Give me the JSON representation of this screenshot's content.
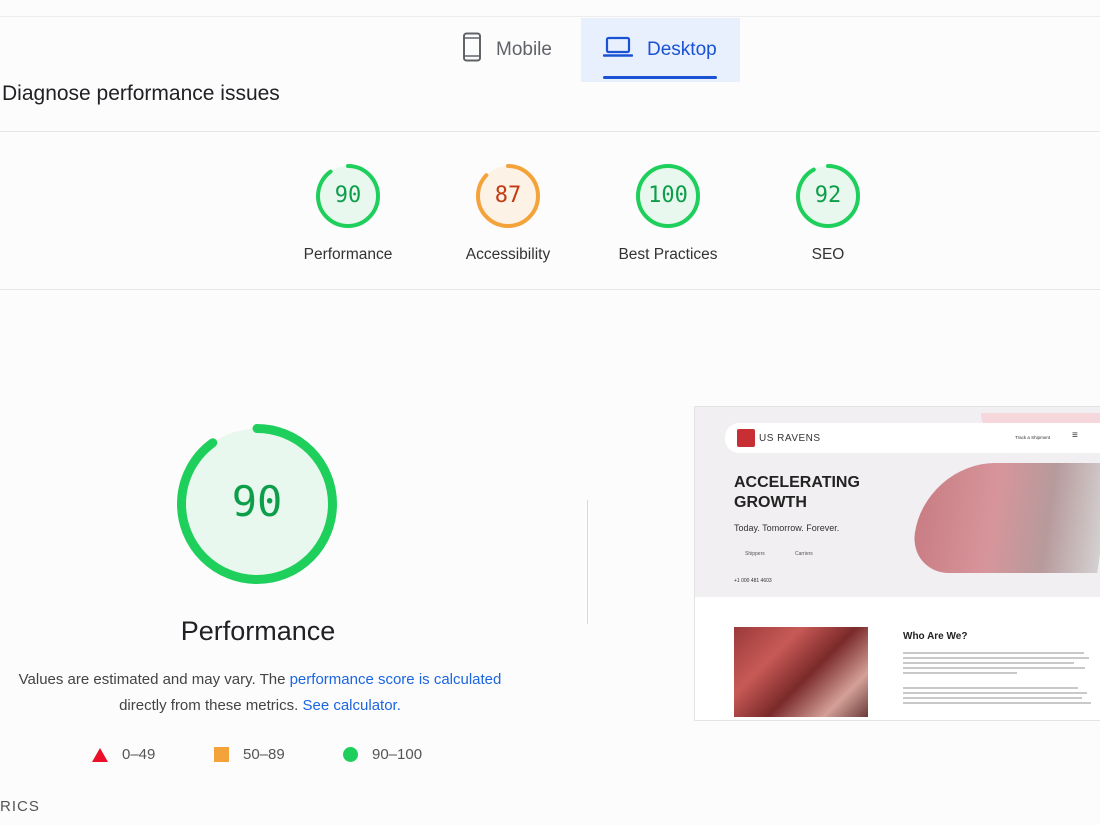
{
  "tabs": {
    "mobile": "Mobile",
    "desktop": "Desktop"
  },
  "section_title": "Diagnose performance issues",
  "scores": [
    {
      "value": "90",
      "label": "Performance",
      "color": "#1fcf5c",
      "text_color": "#0d9e4a",
      "bg": "#e9f8ee",
      "fraction": 0.9
    },
    {
      "value": "87",
      "label": "Accessibility",
      "color": "#f4a23a",
      "text_color": "#c33a10",
      "bg": "#fdf2e6",
      "fraction": 0.87
    },
    {
      "value": "100",
      "label": "Best Practices",
      "color": "#1fcf5c",
      "text_color": "#0d9e4a",
      "bg": "#e9f8ee",
      "fraction": 1.0
    },
    {
      "value": "92",
      "label": "SEO",
      "color": "#1fcf5c",
      "text_color": "#0d9e4a",
      "bg": "#e9f8ee",
      "fraction": 0.92
    }
  ],
  "performance": {
    "score": "90",
    "fraction": 0.9,
    "title": "Performance",
    "desc_prefix": "Values are estimated and may vary. The ",
    "desc_link": "performance score is calculated",
    "desc_middle": "directly from these metrics. ",
    "desc_link2": "See calculator."
  },
  "legend": [
    {
      "shape": "triangle",
      "label": "0–49",
      "color": "#eb0f27"
    },
    {
      "shape": "square",
      "label": "50–89",
      "color": "#f4a23a"
    },
    {
      "shape": "circle",
      "label": "90–100",
      "color": "#1fcf5c"
    }
  ],
  "metrics_heading": "RICS",
  "screenshot": {
    "logo": "US RAVENS",
    "nav_link": "Track a Shipment",
    "headline": "ACCELERATING GROWTH",
    "tagline": "Today. Tomorrow. Forever.",
    "link1": "Shippers",
    "link2": "Carriers",
    "phone": "+1 000 481 4603",
    "who_title": "Who Are We?"
  }
}
